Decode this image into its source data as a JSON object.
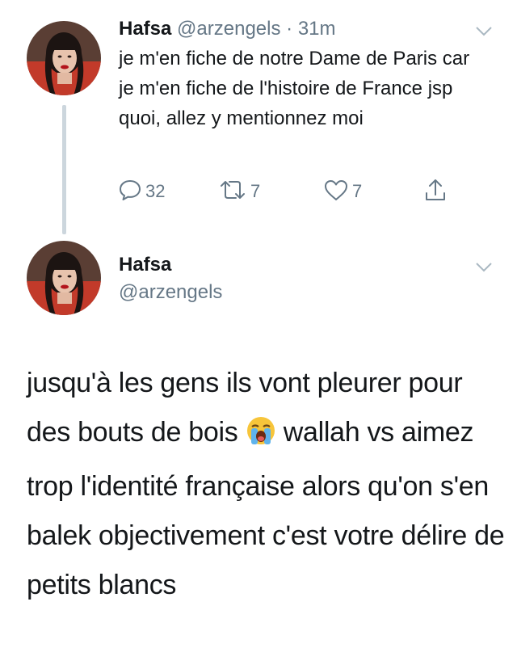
{
  "tweet1": {
    "display_name": "Hafsa",
    "handle": "@arzengels",
    "timestamp": "· 31m",
    "text": "je m'en fiche de notre Dame de Paris car je m'en fiche de l'histoire de France jsp quoi, allez y mentionnez moi",
    "actions": {
      "reply_count": "32",
      "retweet_count": "7",
      "like_count": "7"
    }
  },
  "tweet2": {
    "display_name": "Hafsa",
    "handle": "@arzengels",
    "text_before_emoji": "jusqu'à les gens ils vont pleurer pour des bouts de bois ",
    "emoji": "loudly-crying-face-emoji",
    "text_after_emoji": " wallah vs aimez trop l'identité française alors qu'on s'en balek objectivement c'est votre délire de petits blancs"
  },
  "colors": {
    "primary_text": "#14171a",
    "secondary_text": "#657786",
    "thread_line": "#ccd6dd",
    "icon": "#657786"
  }
}
